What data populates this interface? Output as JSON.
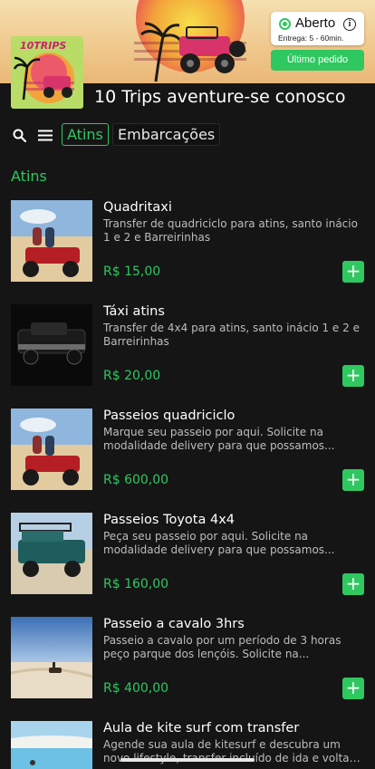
{
  "header": {
    "status": {
      "title": "Aberto",
      "subtitle": "Entrega: 5 - 60min."
    },
    "last_order_label": "Último pedido",
    "store_name": "10 Trips aventure-se conosco"
  },
  "nav": {
    "tabs": [
      {
        "label": "Atins",
        "active": true
      },
      {
        "label": "Embarcações",
        "active": false
      }
    ]
  },
  "section": {
    "title": "Atins"
  },
  "products": [
    {
      "name": "Quadritaxi",
      "description": "Transfer de quadriciclo para atins, santo inácio 1 e 2 e Barreirinhas",
      "price": "R$ 15,00"
    },
    {
      "name": "Táxi atins",
      "description": "Transfer de 4x4 para atins, santo inácio 1 e 2 e Barreirinhas",
      "price": "R$ 20,00"
    },
    {
      "name": "Passeios quadriciclo",
      "description": "Marque seu passeio por aqui. Solicite na modalidade delivery para que possamos...",
      "price": "R$ 600,00"
    },
    {
      "name": "Passeios Toyota 4x4",
      "description": "Peça seu passeio por aqui. Solicite na modalidade delivery para que possamos...",
      "price": "R$ 160,00"
    },
    {
      "name": "Passeio a cavalo 3hrs",
      "description": "Passeio a cavalo por um período de 3 horas peço parque dos lençóis. Solicite na...",
      "price": "R$ 400,00"
    },
    {
      "name": "Aula de kite surf com transfer",
      "description": "Agende sua aula de kitesurf e descubra um novo lifestyle, transfer incluído de ida e volta d...",
      "price": ""
    }
  ],
  "add_label": "+",
  "colors": {
    "accent": "#2fc860",
    "background": "#151515"
  }
}
